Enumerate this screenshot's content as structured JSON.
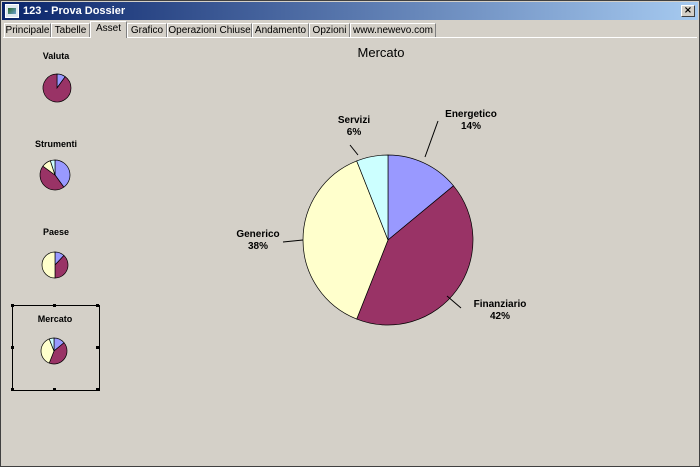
{
  "window": {
    "title": "123 - Prova Dossier"
  },
  "tabs": [
    {
      "label": "Principale"
    },
    {
      "label": "Tabelle"
    },
    {
      "label": "Asset"
    },
    {
      "label": "Grafico"
    },
    {
      "label": "Operazioni Chiuse"
    },
    {
      "label": "Andamento"
    },
    {
      "label": "Opzioni"
    },
    {
      "label": "www.newevo.com"
    }
  ],
  "active_tab": "Asset",
  "colors": {
    "energetico": "#9999ff",
    "finanziario": "#993366",
    "generico": "#ffffcc",
    "servizi": "#ccffff"
  },
  "mini_charts": [
    {
      "title": "Valuta"
    },
    {
      "title": "Strumenti"
    },
    {
      "title": "Paese"
    },
    {
      "title": "Mercato"
    }
  ],
  "chart_data": {
    "type": "pie",
    "title": "Mercato",
    "slices": [
      {
        "label": "Energetico",
        "value": 14,
        "pct_text": "14%"
      },
      {
        "label": "Finanziario",
        "value": 42,
        "pct_text": "42%"
      },
      {
        "label": "Generico",
        "value": 38,
        "pct_text": "38%"
      },
      {
        "label": "Servizi",
        "value": 6,
        "pct_text": "6%"
      }
    ]
  }
}
